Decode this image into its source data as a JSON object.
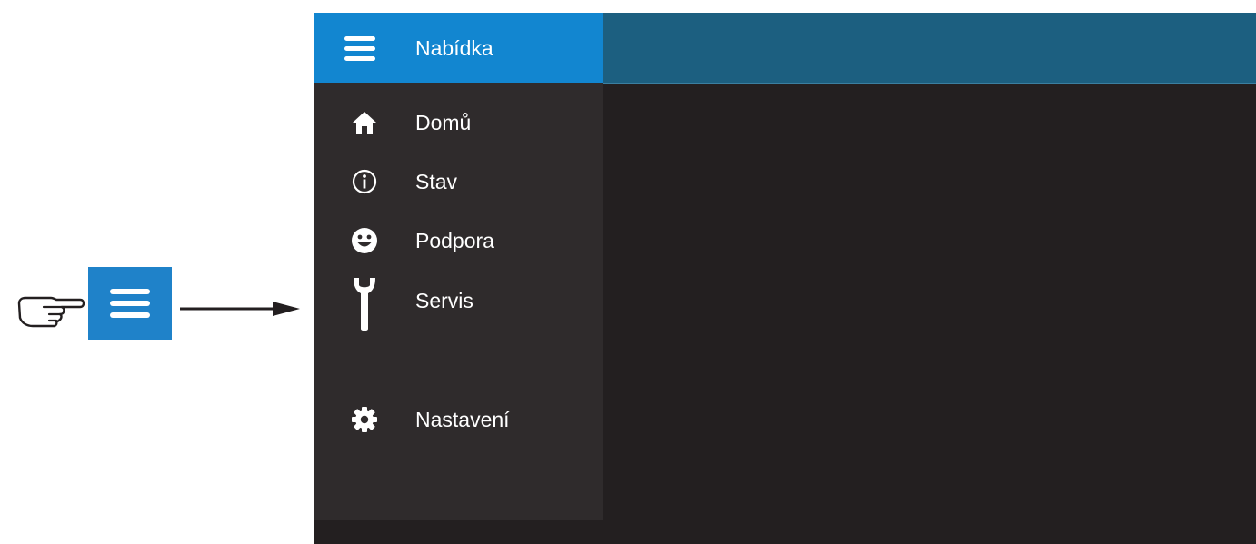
{
  "colors": {
    "accent": "#1286d0",
    "topbar": "#1c5f80",
    "drawer_background": "#2f2b2c",
    "screen_background": "#231f20",
    "text": "#ffffff"
  },
  "annotation": {
    "hand_icon": "pointing-hand-icon",
    "button_icon": "hamburger-icon",
    "arrow_icon": "arrow-right-icon"
  },
  "drawer": {
    "header": {
      "icon": "hamburger-icon",
      "title": "Nabídka"
    },
    "items": [
      {
        "icon": "home-icon",
        "label": "Domů"
      },
      {
        "icon": "info-icon",
        "label": "Stav"
      },
      {
        "icon": "smiley-icon",
        "label": "Podpora"
      },
      {
        "icon": "wrench-icon",
        "label": "Servis"
      },
      {
        "icon": "gear-icon",
        "label": "Nastavení"
      }
    ]
  }
}
